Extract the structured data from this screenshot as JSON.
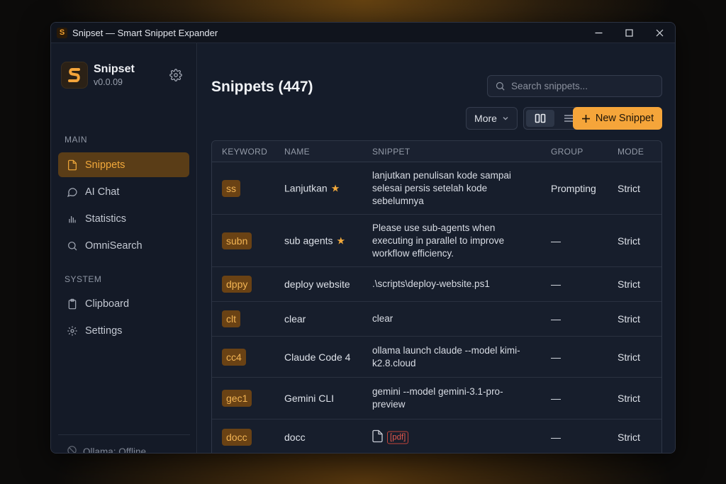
{
  "window": {
    "title": "Snipset — Smart Snippet Expander",
    "app_icon_letter": "S"
  },
  "brand": {
    "name": "Snipset",
    "version": "v0.0.09"
  },
  "sidebar": {
    "main_label": "MAIN",
    "main_items": [
      {
        "label": "Snippets",
        "icon": "file-icon",
        "active": true
      },
      {
        "label": "AI Chat",
        "icon": "chat-icon",
        "active": false
      },
      {
        "label": "Statistics",
        "icon": "bar-chart-icon",
        "active": false
      },
      {
        "label": "OmniSearch",
        "icon": "search-icon",
        "active": false
      }
    ],
    "system_label": "SYSTEM",
    "system_items": [
      {
        "label": "Clipboard",
        "icon": "clipboard-icon"
      },
      {
        "label": "Settings",
        "icon": "gear-icon"
      }
    ],
    "status": "Ollama: Offline"
  },
  "main": {
    "title": "Snippets (447)",
    "search_placeholder": "Search snippets...",
    "more_label": "More",
    "new_label": "New Snippet"
  },
  "table": {
    "headers": {
      "keyword": "KEYWORD",
      "name": "NAME",
      "snippet": "SNIPPET",
      "group": "GROUP",
      "mode": "MODE"
    },
    "rows": [
      {
        "keyword": "ss",
        "name": "Lanjutkan",
        "starred": true,
        "snippet": "lanjutkan penulisan kode sampai selesai persis setelah kode sebelumnya",
        "group": "Prompting",
        "mode": "Strict"
      },
      {
        "keyword": "subn",
        "name": "sub agents",
        "starred": true,
        "snippet": "Please use sub-agents when executing in parallel to improve workflow efficiency.",
        "group": "—",
        "mode": "Strict"
      },
      {
        "keyword": "dppy",
        "name": "deploy website",
        "starred": false,
        "snippet": ".\\scripts\\deploy-website.ps1",
        "group": "—",
        "mode": "Strict"
      },
      {
        "keyword": "clt",
        "name": "clear",
        "starred": false,
        "snippet": "clear",
        "group": "—",
        "mode": "Strict"
      },
      {
        "keyword": "cc4",
        "name": "Claude Code 4",
        "starred": false,
        "snippet": "ollama launch claude --model kimi-k2.8.cloud",
        "group": "—",
        "mode": "Strict"
      },
      {
        "keyword": "gec1",
        "name": "Gemini CLI",
        "starred": false,
        "snippet": "gemini --model gemini-3.1-pro-preview",
        "group": "—",
        "mode": "Strict"
      },
      {
        "keyword": "docc",
        "name": "docc",
        "starred": false,
        "snippet": "[pdf]",
        "group": "—",
        "mode": "Strict"
      }
    ]
  },
  "colors": {
    "accent": "#f5a53a",
    "keyword_bg": "#6a4214",
    "pdf_red": "#e2574c"
  }
}
